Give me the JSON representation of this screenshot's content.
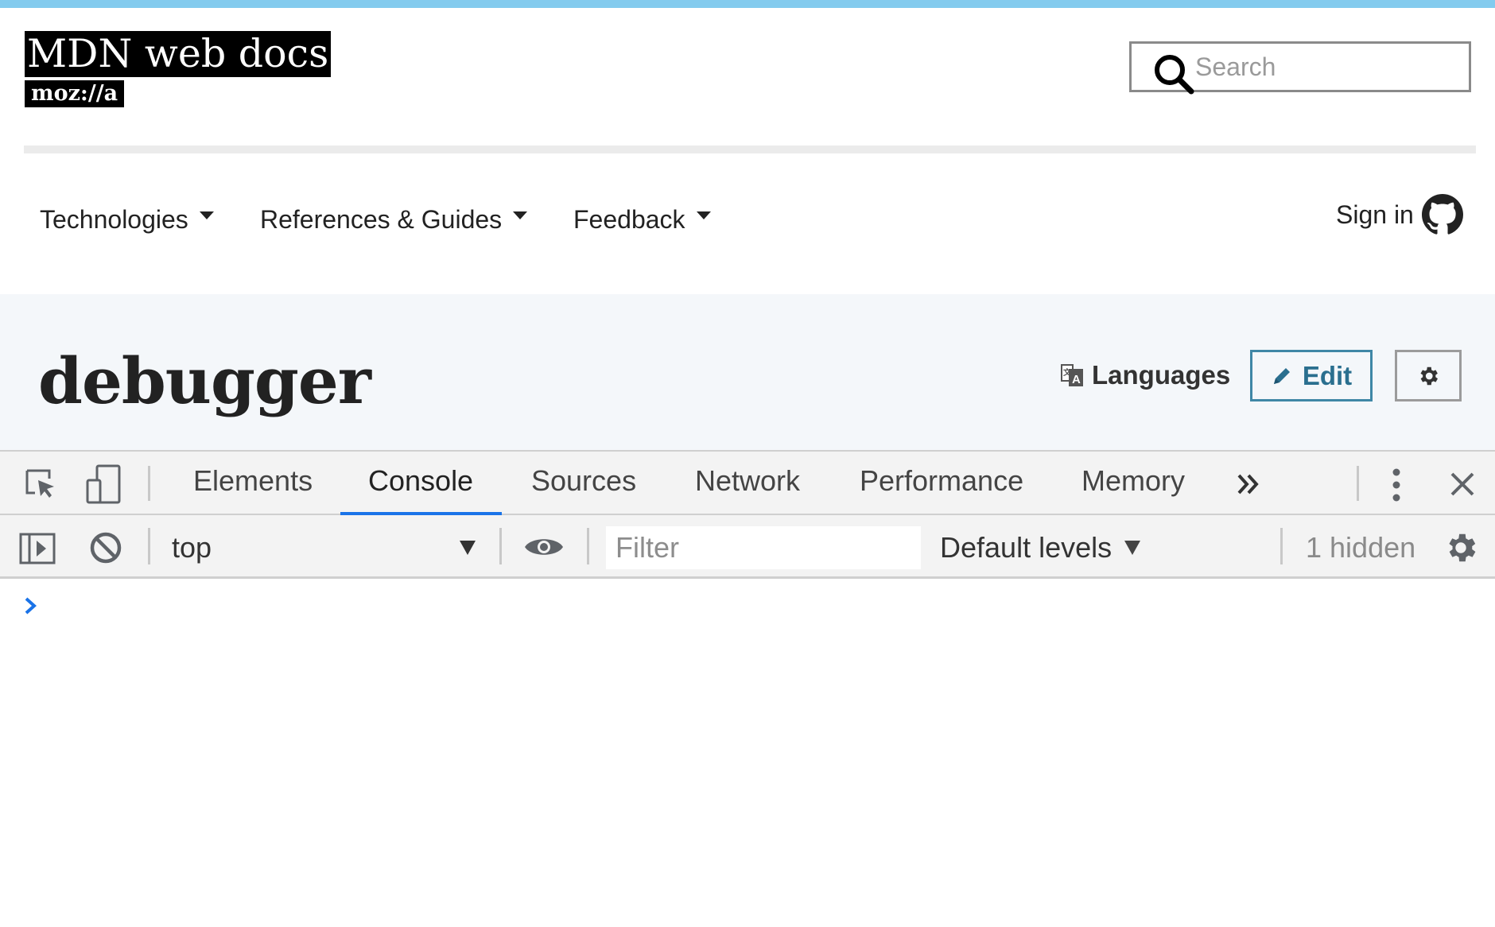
{
  "logo": {
    "title": "MDN web docs",
    "org": "moz://a"
  },
  "search": {
    "placeholder": "Search"
  },
  "nav": {
    "items": [
      {
        "label": "Technologies"
      },
      {
        "label": "References & Guides"
      },
      {
        "label": "Feedback"
      }
    ],
    "signin": "Sign in"
  },
  "page": {
    "title": "debugger",
    "languages": "Languages",
    "edit": "Edit"
  },
  "devtools": {
    "tabs": [
      "Elements",
      "Console",
      "Sources",
      "Network",
      "Performance",
      "Memory"
    ],
    "active_tab": "Console",
    "console": {
      "context": "top",
      "filter_placeholder": "Filter",
      "levels": "Default levels",
      "hidden": "1 hidden"
    }
  },
  "colors": {
    "accent": "#1a73e8",
    "top_stripe": "#83cbee",
    "edit_border": "#3f87a6",
    "title_band": "#f4f7fa"
  }
}
